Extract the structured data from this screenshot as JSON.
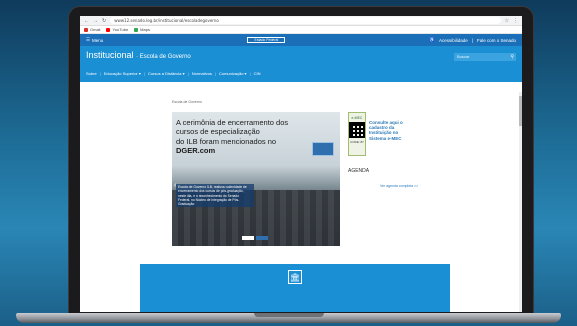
{
  "browser": {
    "url": "www12.senado.leg.br/institucional/escoladegoverno",
    "bookmarks": [
      "Gmail",
      "YouTube",
      "Maps"
    ]
  },
  "gov_bar": {
    "menu_label": "Menu",
    "center_label": "Estado Federal",
    "accessibility_label": "Acessibilidade",
    "contact_label": "Fale com o Senado"
  },
  "header": {
    "title": "Institucional",
    "subtitle": "Escola de Governo",
    "search_placeholder": "Buscar"
  },
  "nav": {
    "items": [
      "Sobre",
      "Educação Superior",
      "Cursos a Distância",
      "Normativos",
      "Comunicação",
      "CIN"
    ]
  },
  "breadcrumb": "Escola de Governo",
  "hero": {
    "title_line1": "A cerimônia de encerramento dos",
    "title_line2": "cursos de especialização",
    "title_line3": "do ILB foram mencionados no",
    "title_bold": "DGER.com",
    "caption": "Escola de Governo ILB, realizou solenidade de encerramento dos cursos de pós-graduação, neste dia, e o reconhecimento do Senado Federal, no Núcleo de Integração de Pós-Graduação"
  },
  "emec": {
    "logo_text": "e-MEC",
    "code": "CODE: 87",
    "text": "Consulte aqui o cadastro da Instituição no Sistema e-MEC"
  },
  "agenda": {
    "title": "AGENDA",
    "link": "Ver agenda completa >>"
  }
}
